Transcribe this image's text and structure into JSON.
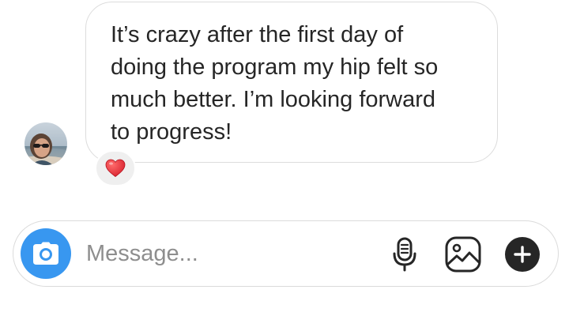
{
  "thread": {
    "message": {
      "text": "It’s crazy after the first day of\ndoing the program my hip felt so\nmuch better. I’m looking forward\nto progress!",
      "reaction_icon": "red-heart-icon"
    },
    "avatar_icon": "user-avatar"
  },
  "composer": {
    "placeholder": "Message...",
    "value": "",
    "camera_icon": "camera-icon",
    "mic_icon": "microphone-icon",
    "gallery_icon": "gallery-icon",
    "plus_icon": "plus-icon"
  },
  "colors": {
    "camera_button": "#3897f0",
    "heart": "#e0242f",
    "text": "#262626",
    "placeholder": "#8e8e8e"
  }
}
